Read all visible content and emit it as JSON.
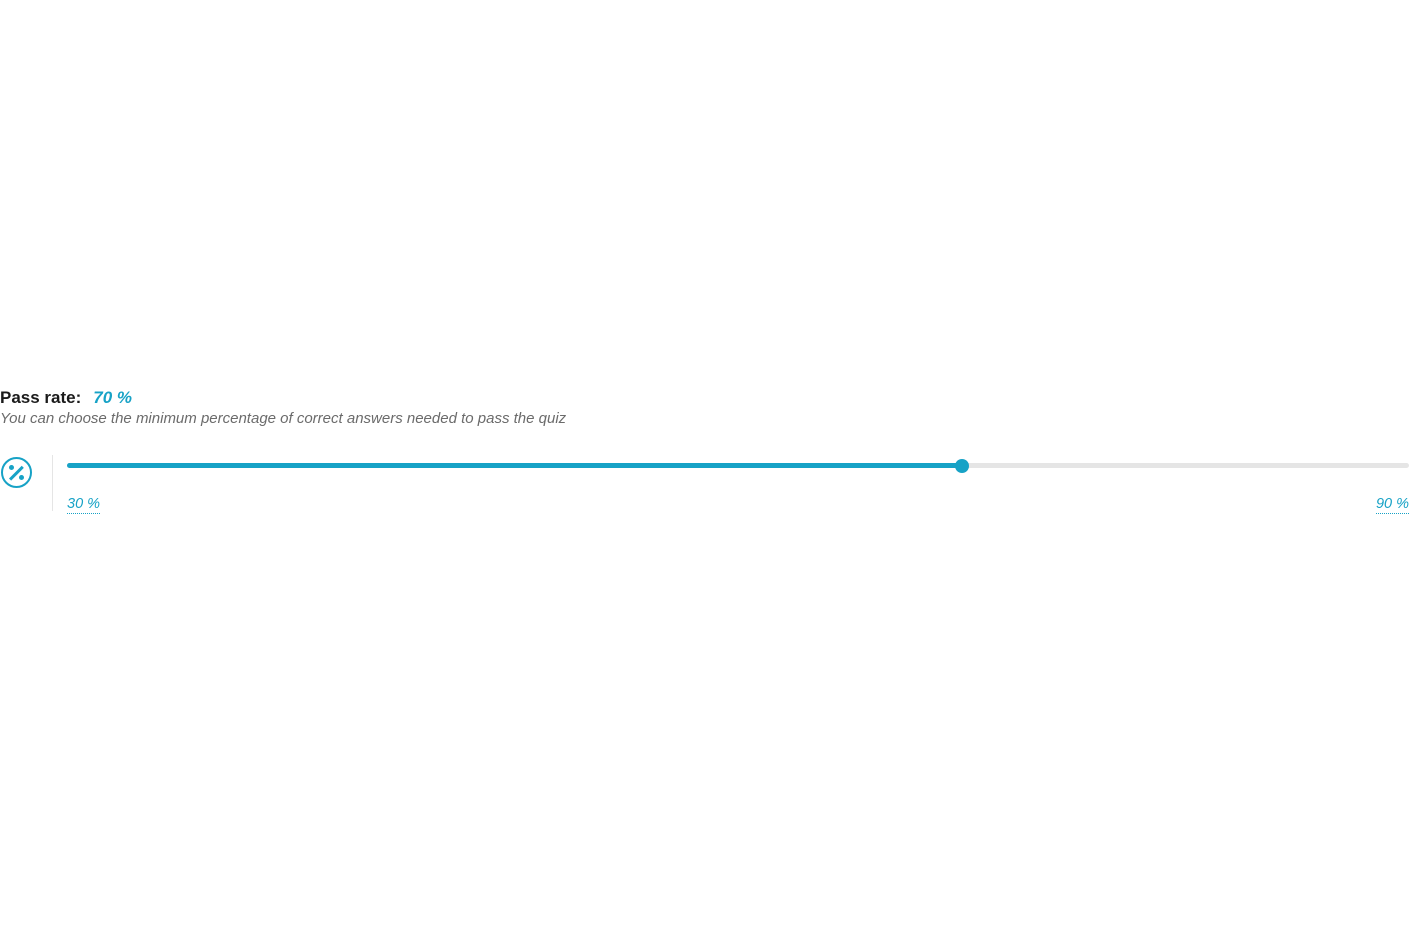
{
  "passRate": {
    "label": "Pass rate:",
    "value": "70 %",
    "description": "You can choose the minimum percentage of correct answers needed to pass the quiz"
  },
  "slider": {
    "min": 30,
    "max": 90,
    "current": 70,
    "minLabel": "30 %",
    "maxLabel": "90 %"
  },
  "colors": {
    "accent": "#17a2c6"
  }
}
